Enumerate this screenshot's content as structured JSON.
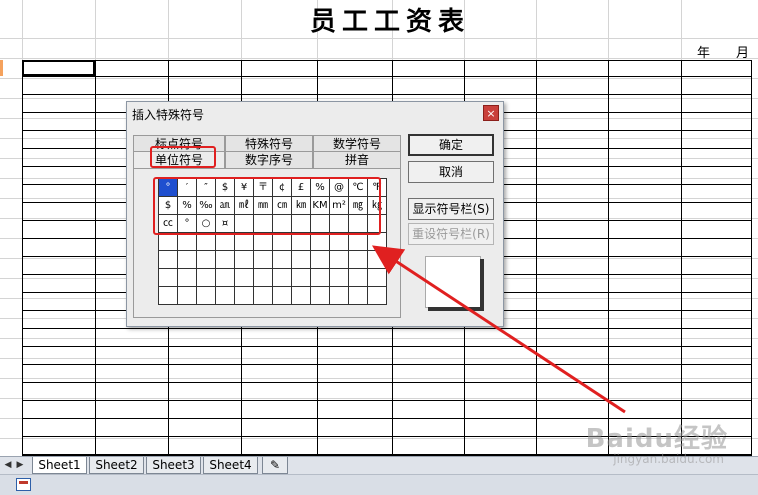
{
  "sheet": {
    "title": "员工工资表",
    "year_label": "年",
    "month_label": "月"
  },
  "sheet_tabs": [
    "Sheet1",
    "Sheet2",
    "Sheet3",
    "Sheet4"
  ],
  "dialog": {
    "title": "插入特殊符号",
    "close_glyph": "×",
    "tabs_row1": [
      "标点符号",
      "特殊符号",
      "数学符号"
    ],
    "tabs_row2": [
      "单位符号",
      "数字序号",
      "拼音"
    ],
    "active_tab": "单位符号",
    "symbols": [
      [
        "°",
        "′",
        "″",
        "$",
        "¥",
        "〒",
        "¢",
        "£",
        "%",
        "@",
        "℃",
        "℉"
      ],
      [
        "$",
        "%",
        "‰",
        "㏂",
        "㎖",
        "㎜",
        "㎝",
        "㎞",
        "KM",
        "m²",
        "㎎",
        "㎏"
      ],
      [
        "㏄",
        "°",
        "○",
        "¤",
        "",
        "",
        "",
        "",
        "",
        "",
        "",
        ""
      ],
      [
        "",
        "",
        "",
        "",
        "",
        "",
        "",
        "",
        "",
        "",
        "",
        ""
      ],
      [
        "",
        "",
        "",
        "",
        "",
        "",
        "",
        "",
        "",
        "",
        "",
        ""
      ],
      [
        "",
        "",
        "",
        "",
        "",
        "",
        "",
        "",
        "",
        "",
        "",
        ""
      ],
      [
        "",
        "",
        "",
        "",
        "",
        "",
        "",
        "",
        "",
        "",
        "",
        ""
      ]
    ],
    "buttons": {
      "ok": "确定",
      "cancel": "取消",
      "show_bar": "显示符号栏(S)",
      "reset_bar": "重设符号栏(R)"
    }
  },
  "watermark": {
    "logo": "Baidu经验",
    "url": "jingyan.baidu.com"
  },
  "colors": {
    "annotation": "#e02020",
    "selected_symbol": "#1f4fcf"
  }
}
